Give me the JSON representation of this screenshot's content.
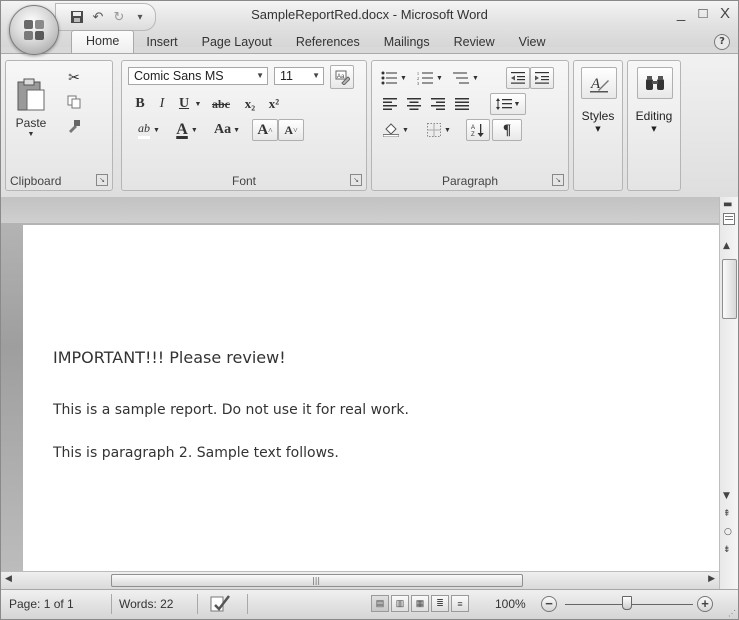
{
  "window": {
    "title": "SampleReportRed.docx - Microsoft Word",
    "controls": {
      "minimize": "_",
      "maximize": "□",
      "close": "X"
    }
  },
  "quick_access": {
    "save_icon": "save-icon",
    "undo_icon": "undo-icon",
    "redo_icon": "redo-icon",
    "customize": "▾"
  },
  "tabs": [
    "Home",
    "Insert",
    "Page Layout",
    "References",
    "Mailings",
    "Review",
    "View"
  ],
  "help": "?",
  "ribbon": {
    "clipboard": {
      "label": "Clipboard",
      "paste_label": "Paste",
      "cut_icon": "scissors-icon",
      "copy_icon": "copy-icon",
      "format_painter_icon": "format-painter-icon"
    },
    "font": {
      "label": "Font",
      "font_name": "Comic Sans MS",
      "font_size": "11",
      "bold": "B",
      "italic": "I",
      "underline": "U",
      "strikethrough": "abc",
      "subscript": "x₂",
      "superscript": "x²",
      "highlight": "ab",
      "font_color": "A",
      "change_case": "Aa",
      "grow": "A",
      "shrink": "A",
      "clear_formatting_icon": "clear-formatting-icon"
    },
    "paragraph": {
      "label": "Paragraph",
      "show_marks": "¶",
      "sort_icon": "sort-icon"
    },
    "styles": {
      "label": "Styles"
    },
    "editing": {
      "label": "Editing"
    }
  },
  "document": {
    "heading": "IMPORTANT!!! Please review!",
    "paragraphs": [
      "This is a sample report. Do not use it for real work.",
      "This is paragraph 2. Sample text follows."
    ]
  },
  "statusbar": {
    "page": "Page: 1 of 1",
    "words": "Words: 22",
    "zoom": "100%",
    "zoom_level_percent": 100
  },
  "colors": {
    "chrome": "#d9d9d9",
    "ribbon": "#e6e6e6",
    "page": "#ffffff",
    "text": "#333333"
  }
}
